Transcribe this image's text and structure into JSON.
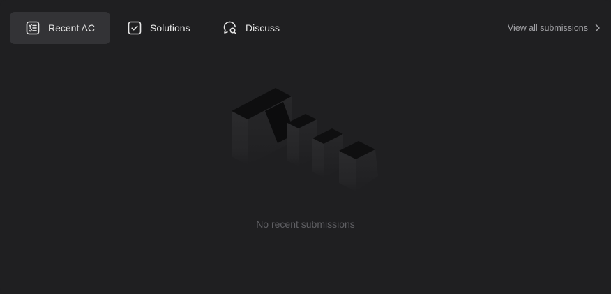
{
  "tabs": [
    {
      "label": "Recent AC",
      "icon": "list-check-icon",
      "active": true
    },
    {
      "label": "Solutions",
      "icon": "checkbox-icon",
      "active": false
    },
    {
      "label": "Discuss",
      "icon": "chat-search-icon",
      "active": false
    }
  ],
  "view_all": {
    "label": "View all submissions",
    "icon": "chevron-right-icon"
  },
  "empty_state": {
    "art_icon": "null-3d-icon",
    "message": "No recent submissions"
  },
  "colors": {
    "background": "#1f1f21",
    "active_tab": "#333336",
    "text": "#e6e6e6",
    "muted_text": "#5f5f63",
    "link_text": "#a0a0a4"
  }
}
